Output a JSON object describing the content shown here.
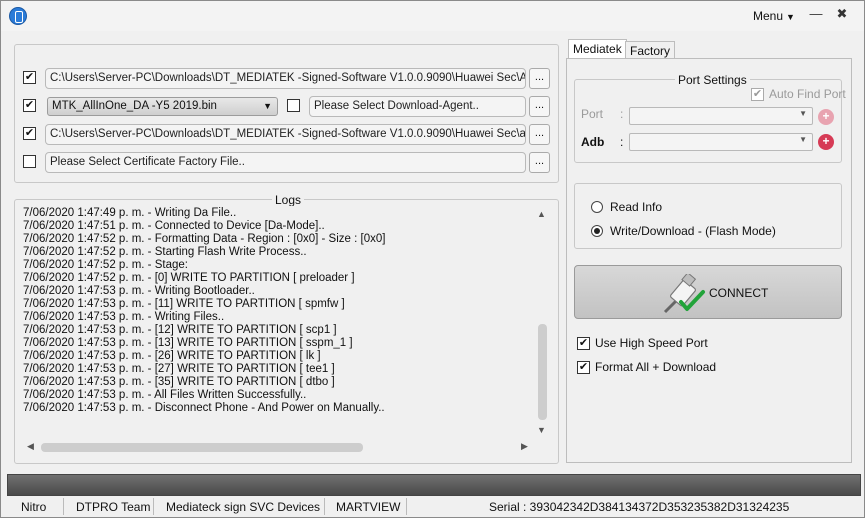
{
  "titlebar": {
    "menu_label": "Menu",
    "minimize_glyph": "—",
    "close_glyph": "✖"
  },
  "files": {
    "row1": {
      "checked": true,
      "value": "C:\\Users\\Server-PC\\Downloads\\DT_MEDIATEK -Signed-Software V1.0.0.9090\\Huawei Sec\\Andro"
    },
    "row2": {
      "checked": true,
      "scatter": "MTK_AllInOne_DA -Y5 2019.bin",
      "da_checked": false,
      "da_placeholder": "Please Select Download-Agent.."
    },
    "row3": {
      "checked": true,
      "value": "C:\\Users\\Server-PC\\Downloads\\DT_MEDIATEK -Signed-Software V1.0.0.9090\\Huawei Sec\\auth_"
    },
    "row4": {
      "checked": false,
      "placeholder": "Please Select Certificate Factory File.."
    },
    "browse_label": "..."
  },
  "logs": {
    "title": "Logs",
    "lines": [
      "7/06/2020 1:47:49 p. m. - Writing Da File..",
      "7/06/2020 1:47:51 p. m. - Connected to Device [Da-Mode]..",
      "7/06/2020 1:47:52 p. m. - Formatting Data - Region : [0x0] - Size : [0x0]",
      "7/06/2020 1:47:52 p. m. - Starting Flash Write Process..",
      "7/06/2020 1:47:52 p. m. - Stage:",
      "7/06/2020 1:47:52 p. m. - [0] WRITE TO PARTITION [ preloader ]",
      "7/06/2020 1:47:53 p. m. - Writing Bootloader..",
      "7/06/2020 1:47:53 p. m. - [11] WRITE TO PARTITION [ spmfw ]",
      "7/06/2020 1:47:53 p. m. - Writing Files..",
      "7/06/2020 1:47:53 p. m. - [12] WRITE TO PARTITION [ scp1 ]",
      "7/06/2020 1:47:53 p. m. - [13] WRITE TO PARTITION [ sspm_1 ]",
      "7/06/2020 1:47:53 p. m. - [26] WRITE TO PARTITION [ lk ]",
      "7/06/2020 1:47:53 p. m. - [27] WRITE TO PARTITION [ tee1 ]",
      "7/06/2020 1:47:53 p. m. - [35] WRITE TO PARTITION [ dtbo ]",
      "7/06/2020 1:47:53 p. m. - All Files Written Successfully..",
      "7/06/2020 1:47:53 p. m. - Disconnect Phone - And Power on Manually.."
    ]
  },
  "tabs": [
    {
      "label": "Mediatek",
      "active": true
    },
    {
      "label": "Factory",
      "active": false
    }
  ],
  "port_settings": {
    "title": "Port Settings",
    "auto_find_label": "Auto Find Port",
    "auto_find_checked": true,
    "port_label": "Port",
    "adb_label": "Adb",
    "colon": ":",
    "port_value": "",
    "adb_value": ""
  },
  "mode": {
    "read_info_label": "Read Info",
    "write_download_label": "Write/Download - (Flash Mode)",
    "selected": "write_download"
  },
  "connect": {
    "label": "CONNECT"
  },
  "options": {
    "high_speed": {
      "label": "Use High Speed Port",
      "checked": true
    },
    "format_all": {
      "label": "Format All + Download",
      "checked": true
    }
  },
  "progress": {
    "value": 0
  },
  "statusbar": {
    "items": [
      "Nitro",
      "DTPRO Team",
      "Mediateck sign SVC Devices",
      "MARTVIEW"
    ],
    "serial": "Serial : 393042342D384134372D353235382D31324235"
  },
  "icons": {
    "app": "app-logo-icon",
    "menu_caret": "caret-down-icon",
    "connect": "usb-cable-check-icon",
    "add": "plus-circle-icon"
  },
  "colors": {
    "plus_active": "#d63a55",
    "plus_disabled": "#e8a3b0",
    "check_green": "#22a33a",
    "progress_bar": "#5a5a5a",
    "app_icon": "#2a7bd8"
  }
}
